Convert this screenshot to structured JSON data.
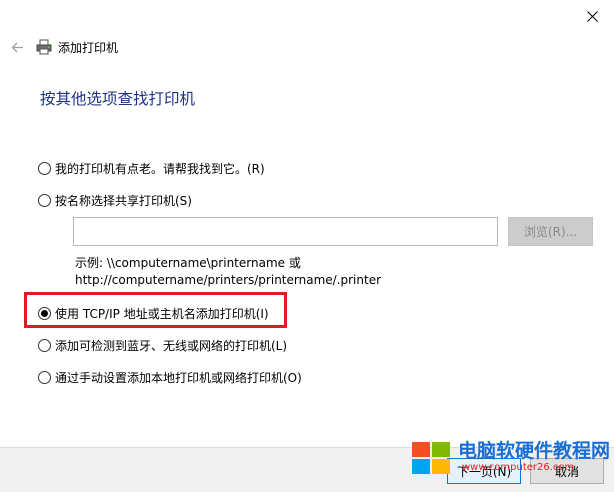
{
  "window": {
    "title": "添加打印机"
  },
  "page": {
    "title": "按其他选项查找打印机"
  },
  "options": [
    {
      "label": "我的打印机有点老。请帮我找到它。(R)",
      "checked": false
    },
    {
      "label": "按名称选择共享打印机(S)",
      "checked": false
    },
    {
      "label": "使用 TCP/IP 地址或主机名添加打印机(I)",
      "checked": true
    },
    {
      "label": "添加可检测到蓝牙、无线或网络的打印机(L)",
      "checked": false
    },
    {
      "label": "通过手动设置添加本地打印机或网络打印机(O)",
      "checked": false
    }
  ],
  "shared_printer": {
    "input_value": "",
    "browse_label": "浏览(R)...",
    "example_line1": "示例: \\\\computername\\printername 或",
    "example_line2": "http://computername/printers/printername/.printer"
  },
  "footer": {
    "next_label": "下一页(N)",
    "cancel_label": "取消"
  },
  "watermark": {
    "title": "电脑软硬件教程网",
    "url": "www.computer26.com"
  },
  "colors": {
    "title_blue": "#1e3287",
    "highlight_red": "#e11b22",
    "accent_blue": "#0078d7"
  },
  "icons": [
    "close-icon",
    "back-arrow-icon",
    "printer-icon",
    "windows-logo-icon"
  ]
}
